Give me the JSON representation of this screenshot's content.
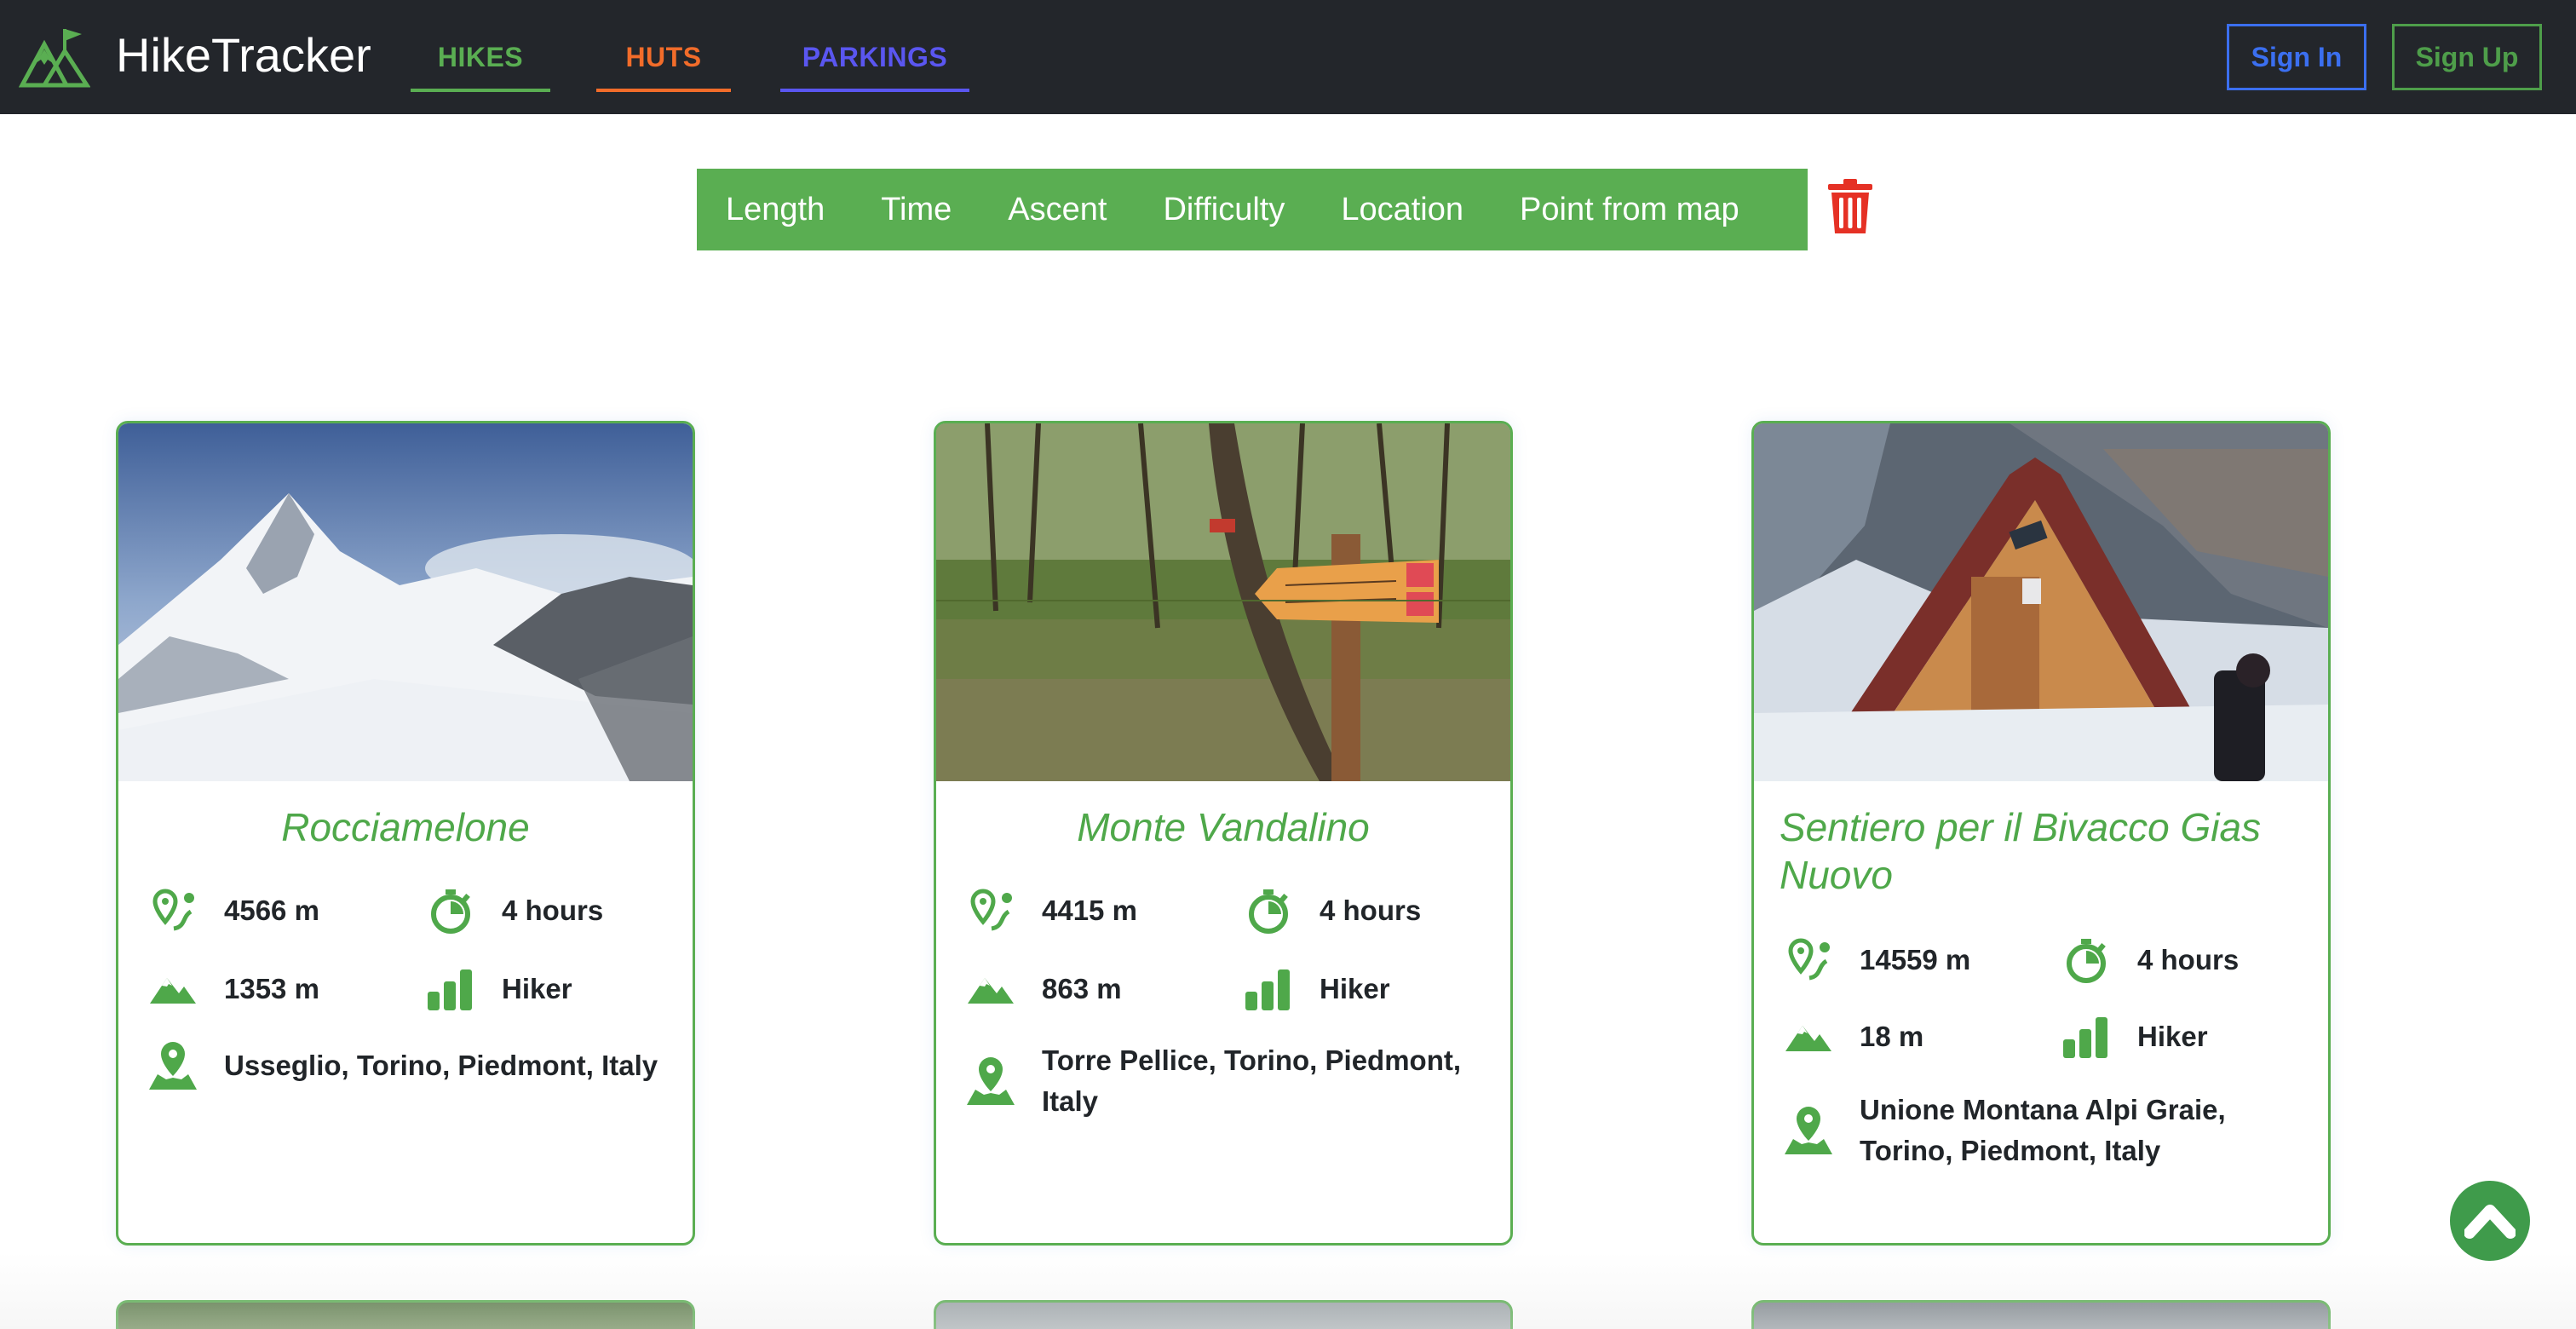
{
  "app": {
    "brand": "HikeTracker"
  },
  "nav": {
    "hikes": "HIKES",
    "huts": "HUTS",
    "parkings": "PARKINGS",
    "sign_in": "Sign In",
    "sign_up": "Sign Up"
  },
  "filters": [
    "Length",
    "Time",
    "Ascent",
    "Difficulty",
    "Location",
    "Point from map"
  ],
  "colors": {
    "navbar": "#23262b",
    "green": "#5aae52",
    "huts_orange": "#f26c2a",
    "parkings_blue": "#5a56f0",
    "sign_in_blue": "#3b6ff0",
    "trash_red": "#e53125"
  },
  "icons": {
    "length": "route-pin-icon",
    "time": "stopwatch-icon",
    "ascent": "mountain-icon",
    "difficulty": "signal-bars-icon",
    "location": "map-pin-icon",
    "clear_filters": "trash-icon",
    "scroll_top": "chevron-up-icon"
  },
  "hikes": [
    {
      "title": "Rocciamelone",
      "length": "4566 m",
      "time": "4 hours",
      "ascent": "1353 m",
      "difficulty": "Hiker",
      "location": "Usseglio, Torino, Piedmont, Italy"
    },
    {
      "title": "Monte Vandalino",
      "length": "4415 m",
      "time": "4 hours",
      "ascent": "863 m",
      "difficulty": "Hiker",
      "location": "Torre Pellice, Torino, Piedmont, Italy"
    },
    {
      "title": "Sentiero per il Bivacco Gias Nuovo",
      "length": "14559 m",
      "time": "4 hours",
      "ascent": "18 m",
      "difficulty": "Hiker",
      "location": "Unione Montana Alpi Graie, Torino, Piedmont, Italy"
    }
  ]
}
